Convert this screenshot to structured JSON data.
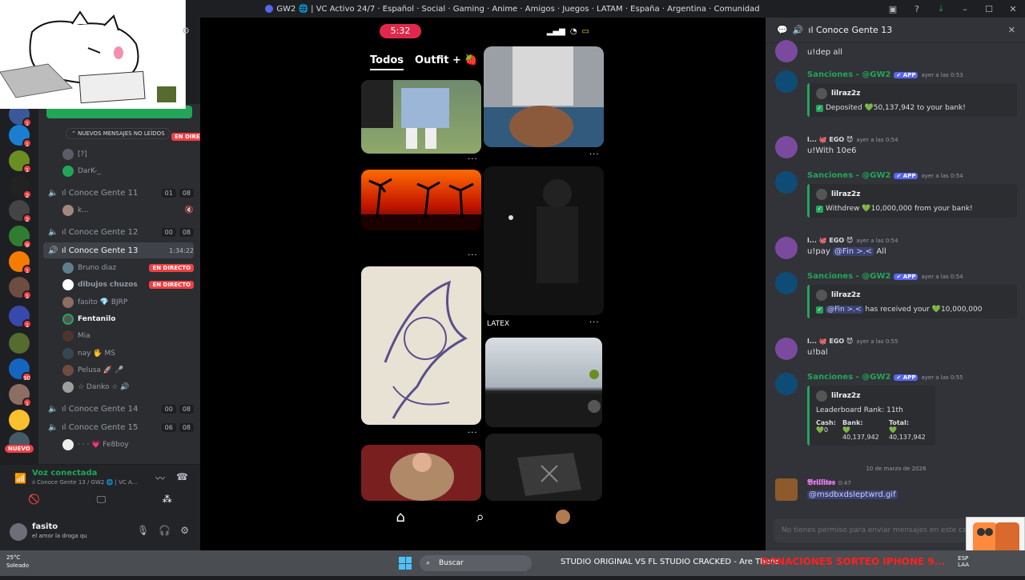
{
  "window": {
    "title": "GW2 🌐 | VC Activo 24/7 · Español · Social · Gaming · Anime · Amigos · Juegos · LATAM · España · Argentina · Comunidad"
  },
  "servers": {
    "badges": [
      "1",
      "1",
      "1",
      "2",
      "2",
      "9",
      "1",
      "1",
      "1",
      "90",
      "1"
    ],
    "nuevo_label": "NUEVO"
  },
  "channels": {
    "unread_pill": "NUEVOS MENSAJES NO LEÍDOS",
    "top_users": [
      "[?]",
      "DarK-_"
    ],
    "rows": [
      {
        "label": "ıl Conoce Gente 11",
        "a": "01",
        "b": "08"
      },
      {
        "label": "ıl Conoce Gente 12",
        "a": "00",
        "b": "08"
      },
      {
        "label": "ıl Conoce Gente 13",
        "time": "1:34:22"
      },
      {
        "label": "ıl Conoce Gente 14",
        "a": "00",
        "b": "08"
      },
      {
        "label": "ıl Conoce Gente 15",
        "a": "06",
        "b": "08"
      }
    ],
    "k_user": "k...",
    "users13": [
      {
        "name": "Bruno diaz",
        "live": "EN DIRECTO"
      },
      {
        "name": "𝗱𝗶𝗯𝘂𝗷𝗼𝘀 𝗰𝗵𝘂𝘇𝗼𝘀",
        "live": "EN DIRECTO"
      },
      {
        "name": "fasito 💎 BJRP"
      },
      {
        "name": "Fentanilo"
      },
      {
        "name": "Mia"
      },
      {
        "name": "nay 🖐 MS"
      },
      {
        "name": "Pelusa 🚀 🎤"
      },
      {
        "name": "☆ Danko ☆ 🔊"
      }
    ],
    "users15": [
      {
        "name": "· · · 💗 Fe8boy"
      }
    ],
    "live_top": "EN DIRECTO"
  },
  "voice": {
    "title": "Voz conectada",
    "sub": "ıl Conoce Gente 13 / GW2 🌐 | VC A..."
  },
  "user": {
    "name": "fasito",
    "status": "el amor la droga qu"
  },
  "stream": {
    "time": "5:32",
    "tabs": [
      "Todos",
      "Outfit + 🍓"
    ],
    "latex_label": "LATEX"
  },
  "chat": {
    "channel": "ıl Conoce Gente 13",
    "messages": [
      {
        "type": "cont",
        "text": "u!dep all"
      },
      {
        "type": "bot",
        "name": "Sanciones - @GW2",
        "tag": "✔ APP",
        "ts": "ayer a las 0:53",
        "embed_author": "lilraz2z",
        "embed_lines": [
          "Deposited 💚50,137,942 to your bank!"
        ]
      },
      {
        "type": "user",
        "name": "l... 🐙 EGO 😈",
        "ts": "ayer a las 0:54",
        "text": "u!With 10e6"
      },
      {
        "type": "bot",
        "name": "Sanciones - @GW2",
        "tag": "✔ APP",
        "ts": "ayer a las 0:54",
        "embed_author": "lilraz2z",
        "embed_lines": [
          "Withdrew 💚10,000,000 from your bank!"
        ]
      },
      {
        "type": "user",
        "name": "l... 🐙 EGO 😈",
        "ts": "ayer a las 0:54",
        "text_pre": "u!pay ",
        "mention": "@Fin >.<",
        "text_post": " All"
      },
      {
        "type": "bot",
        "name": "Sanciones - @GW2",
        "tag": "✔ APP",
        "ts": "ayer a las 0:54",
        "embed_author": "lilraz2z",
        "mention": "@Fin >.<",
        "embed_lines": [
          "has received your 💚10,000,000"
        ]
      },
      {
        "type": "user",
        "name": "l... 🐙 EGO 😈",
        "ts": "ayer a las 0:55",
        "text": "u!bal"
      },
      {
        "type": "bot",
        "name": "Sanciones - @GW2",
        "tag": "✔ APP",
        "ts": "ayer a las 0:55",
        "embed_author": "lilraz2z",
        "embed_lines": [
          "Leaderboard Rank: 11th"
        ],
        "fields": [
          {
            "k": "Cash:",
            "v": "💚0"
          },
          {
            "k": "Bank:",
            "v": "💚40,137,942"
          },
          {
            "k": "Total:",
            "v": "💚40,137,942"
          }
        ]
      }
    ],
    "date_divider": "10 de marzo de 2026",
    "last": {
      "name": "𝕭𝖗𝖎𝖑𝖑𝖎𝖙𝖔𝖘",
      "ts": "0:47",
      "link": "@msdbxdsleptwrd.gif"
    },
    "input_placeholder": "No tienes permiso para enviar mensajes en este canal."
  },
  "taskbar": {
    "weather_temp": "25°C",
    "weather_desc": "Soleado",
    "search": "Buscar",
    "ticker": "STUDIO ORIGINAL VS FL STUDIO CRACKED - Are There",
    "ticker_red": "DONACIONES SORTEO IPHONE 9...",
    "lang": "ESP",
    "lang2": "LAA"
  }
}
